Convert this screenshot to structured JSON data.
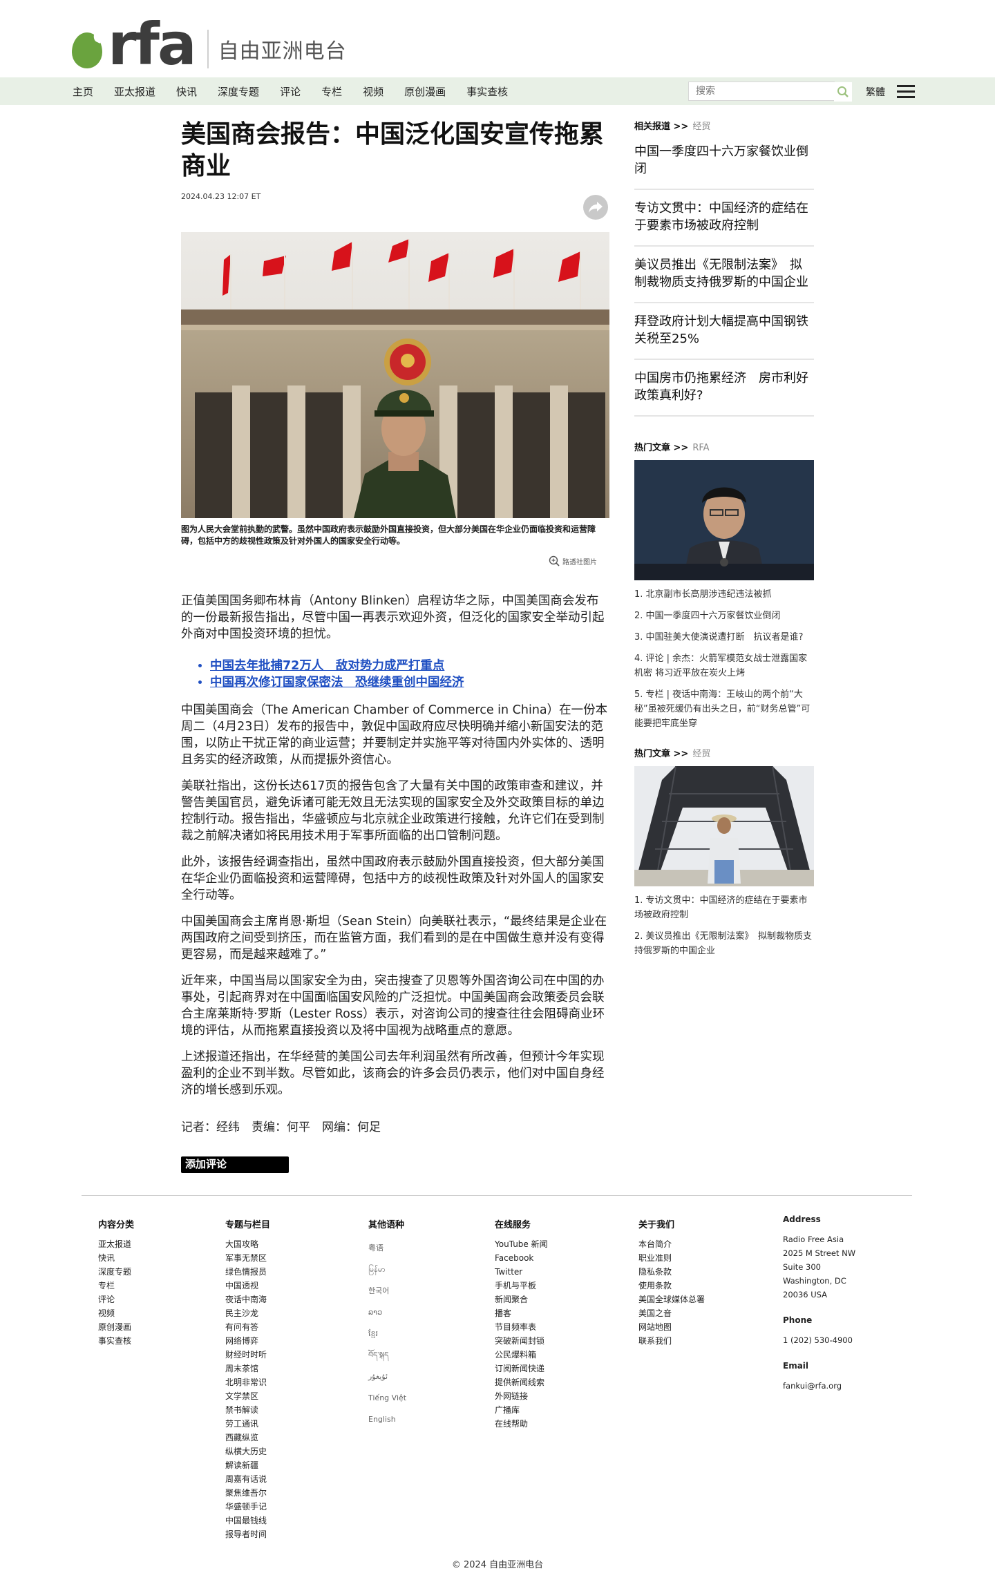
{
  "header": {
    "logo_text": "rfa",
    "logo_cn": "自由亚洲电台",
    "nav": [
      "主页",
      "亚太报道",
      "快讯",
      "深度专题",
      "评论",
      "专栏",
      "视频",
      "原创漫画",
      "事实查核"
    ],
    "search_placeholder": "搜索",
    "lang_toggle": "繁體"
  },
  "article": {
    "title": "美国商会报告：中国泛化国安宣传拖累商业",
    "date": "2024.04.23 12:07 ET",
    "caption": "图为人民大会堂前执勤的武警。虽然中国政府表示鼓励外国直接投资，但大部分美国在华企业仍面临投资和运营障碍，包括中方的歧视性政策及针对外国人的国家安全行动等。",
    "credit": "路透社图片",
    "p1": "正值美国国务卿布林肯（Antony Blinken）启程访华之际，中国美国商会发布的一份最新报告指出，尽管中国一再表示欢迎外资，但泛化的国家安全举动引起外商对中国投资环境的担忧。",
    "links": [
      "中国去年批捕72万人　敌对势力成严打重点",
      "中国再次修订国家保密法　恐继续重创中国经济"
    ],
    "p2": "中国美国商会（The American Chamber of Commerce in China）在一份本周二（4月23日）发布的报告中，敦促中国政府应尽快明确并缩小新国安法的范围，以防止干扰正常的商业运营；并要制定并实施平等对待国内外实体的、透明且务实的经济政策，从而提振外资信心。",
    "p3": "美联社指出，这份长达617页的报告包含了大量有关中国的政策审查和建议，并警告美国官员，避免诉诸可能无效且无法实现的国家安全及外交政策目标的单边控制行动。报告指出，华盛顿应与北京就企业政策进行接触，允许它们在受到制裁之前解决诸如将民用技术用于军事所面临的出口管制问题。",
    "p4": "此外，该报告经调查指出，虽然中国政府表示鼓励外国直接投资，但大部分美国在华企业仍面临投资和运营障碍，包括中方的歧视性政策及针对外国人的国家安全行动等。",
    "p5": "中国美国商会主席肖恩·斯坦（Sean Stein）向美联社表示，“最终结果是企业在两国政府之间受到挤压，而在监管方面，我们看到的是在中国做生意并没有变得更容易，而是越来越难了。”",
    "p6": "近年来，中国当局以国家安全为由，突击搜查了贝恩等外国咨询公司在中国的办事处，引起商界对在中国面临国安风险的广泛担忧。中国美国商会政策委员会联合主席莱斯特·罗斯（Lester Ross）表示，对咨询公司的搜查往往会阻碍商业环境的评估，从而拖累直接投资以及将中国视为战略重点的意愿。",
    "p7": "上述报道还指出，在华经营的美国公司去年利润虽然有所改善，但预计今年实现盈利的企业不到半数。尽管如此，该商会的许多会员仍表示，他们对中国自身经济的增长感到乐观。",
    "byline": "记者：经纬　责编：何平　网编：何足",
    "comment_btn": "添加评论"
  },
  "sidebar": {
    "related_head": "相关报道 >>",
    "related_sub": "经贸",
    "related": [
      "中国一季度四十六万家餐饮业倒闭",
      "专访文贯中：中国经济的症结在于要素市场被政府控制",
      "美议员推出《无限制法案》　拟制裁物质支持俄罗斯的中国企业",
      "拜登政府计划大幅提高中国钢铁关税至25%",
      "中国房市仍拖累经济　房市利好政策真利好?"
    ],
    "hot1_head": "热门文章 >>",
    "hot1_sub": "RFA",
    "hot1": [
      "1. 北京副市长高朋涉违纪违法被抓",
      "2. 中国一季度四十六万家餐饮业倒闭",
      "3. 中国驻美大使演说遭打断　抗议者是谁?",
      "4. 评论 | 余杰：火箭军模范女战士泄露国家机密 将习近平放在炭火上烤",
      "5. 专栏 | 夜话中南海：王岐山的两个前“大秘”虽被死缓仍有出头之日，前“财务总管”可能要把牢底坐穿"
    ],
    "hot2_head": "热门文章 >>",
    "hot2_sub": "经贸",
    "hot2": [
      "1. 专访文贯中：中国经济的症结在于要素市场被政府控制",
      "2. 美议员推出《无限制法案》　拟制裁物质支持俄罗斯的中国企业"
    ]
  },
  "footer": {
    "col1_head": "内容分类",
    "col1": [
      "亚太报道",
      "快讯",
      "深度专题",
      "专栏",
      "评论",
      "视频",
      "原创漫画",
      "事实查核"
    ],
    "col2_head": "专题与栏目",
    "col2": [
      "大国攻略",
      "军事无禁区",
      "绿色情报员",
      "中国透视",
      "夜话中南海",
      "民主沙龙",
      "有问有答",
      "网络博弈",
      "财经时时听",
      "周末茶馆",
      "北明非常识",
      "文学禁区",
      "禁书解读",
      "劳工通讯",
      "西藏纵览",
      "纵横大历史",
      "解读新疆",
      "周嘉有话说",
      "聚焦维吾尔",
      "华盛顿手记",
      "中国最钱线",
      "报导者时间"
    ],
    "col3_head": "其他语种",
    "col3": [
      "粤语",
      "မြန်မာ",
      "한국어",
      "ລາວ",
      "ខ្មែរ",
      "བོད་སྐད",
      "ئۇيغۇر",
      "Tiếng Việt",
      "English"
    ],
    "col4_head": "在线服务",
    "col4": [
      "YouTube 新闻",
      "Facebook",
      "Twitter",
      "手机与平板",
      "新闻聚合",
      "播客",
      "节目频率表",
      "突破新闻封锁",
      "公民爆料箱",
      "订阅新闻快递",
      "提供新闻线索",
      "外网链接",
      "广播库",
      "在线帮助"
    ],
    "col5_head": "关于我们",
    "col5": [
      "本台简介",
      "职业准则",
      "隐私条款",
      "使用条款",
      "美国全球媒体总署",
      "美国之音",
      "网站地图",
      "联系我们"
    ],
    "address_head": "Address",
    "address_lines": [
      "Radio Free Asia",
      "2025 M Street NW",
      "Suite 300",
      "Washington, DC",
      "20036 USA"
    ],
    "phone_head": "Phone",
    "phone": "1 (202) 530-4900",
    "email_head": "Email",
    "email": "fankui@rfa.org",
    "copyright": "© 2024 自由亚洲电台"
  },
  "colors": {
    "nav_bg": "#e8f0e6",
    "logo_green": "#6aa33e",
    "link_blue": "#1f4fc2"
  }
}
